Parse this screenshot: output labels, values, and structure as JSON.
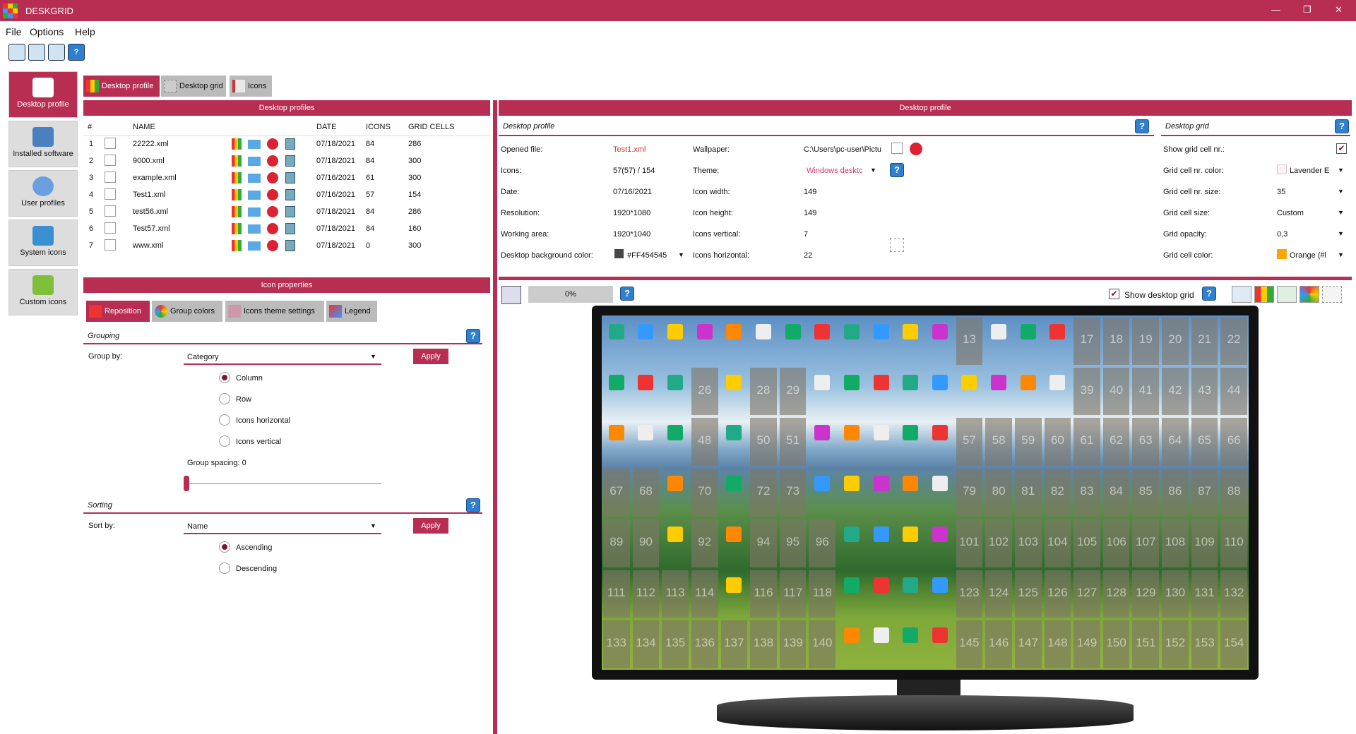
{
  "app": {
    "title": "DESKGRID"
  },
  "menu": [
    "File",
    "Options",
    "Help"
  ],
  "sidebar": [
    {
      "label": "Desktop profile",
      "active": true
    },
    {
      "label": "Installed software"
    },
    {
      "label": "User profiles"
    },
    {
      "label": "System icons"
    },
    {
      "label": "Custom icons"
    }
  ],
  "tabs": [
    {
      "label": "Desktop profile",
      "active": true
    },
    {
      "label": "Desktop grid"
    },
    {
      "label": "Icons"
    }
  ],
  "profiles": {
    "header": "Desktop profiles",
    "columns": [
      "#",
      "NAME",
      "DATE",
      "ICONS",
      "GRID CELLS"
    ],
    "rows": [
      {
        "n": "1",
        "name": "22222.xml",
        "date": "07/18/2021",
        "icons": "84",
        "cells": "286"
      },
      {
        "n": "2",
        "name": "9000.xml",
        "date": "07/18/2021",
        "icons": "84",
        "cells": "300"
      },
      {
        "n": "3",
        "name": "example.xml",
        "date": "07/16/2021",
        "icons": "61",
        "cells": "300"
      },
      {
        "n": "4",
        "name": "Test1.xml",
        "date": "07/16/2021",
        "icons": "57",
        "cells": "154"
      },
      {
        "n": "5",
        "name": "test56.xml",
        "date": "07/18/2021",
        "icons": "84",
        "cells": "286"
      },
      {
        "n": "6",
        "name": "Test57.xml",
        "date": "07/18/2021",
        "icons": "84",
        "cells": "160"
      },
      {
        "n": "7",
        "name": "www.xml",
        "date": "07/18/2021",
        "icons": "0",
        "cells": "300"
      }
    ]
  },
  "icon_props": {
    "header": "Icon properties",
    "tabs": [
      "Reposition",
      "Group colors",
      "Icons theme settings",
      "Legend"
    ],
    "grouping": {
      "title": "Grouping",
      "group_by_label": "Group by:",
      "group_by": "Category",
      "apply": "Apply",
      "options": [
        "Column",
        "Row",
        "Icons horizontal",
        "Icons vertical"
      ],
      "selected": "Column",
      "spacing_label": "Group spacing: 0"
    },
    "sorting": {
      "title": "Sorting",
      "sort_by_label": "Sort by:",
      "sort_by": "Name",
      "apply": "Apply",
      "options": [
        "Ascending",
        "Descending"
      ],
      "selected": "Ascending"
    }
  },
  "right": {
    "header": "Desktop profile",
    "profile_title": "Desktop profile",
    "grid_title": "Desktop grid",
    "fields": {
      "opened_file_label": "Opened file:",
      "opened_file": "Test1.xml",
      "icons_label": "Icons:",
      "icons": "57(57) / 154",
      "date_label": "Date:",
      "date": "07/16/2021",
      "resolution_label": "Resolution:",
      "resolution": "1920*1080",
      "working_label": "Working area:",
      "working": "1920*1040",
      "bg_label": "Desktop background color:",
      "bg": "#FF454545",
      "wallpaper_label": "Wallpaper:",
      "wallpaper": "C:\\Users\\pc-user\\Pictu",
      "theme_label": "Theme:",
      "theme": "Windows desktc",
      "icon_width_label": "Icon width:",
      "icon_width": "149",
      "icon_height_label": "Icon height:",
      "icon_height": "149",
      "icons_vertical_label": "Icons vertical:",
      "icons_vertical": "7",
      "icons_horizontal_label": "Icons horizontal:",
      "icons_horizontal": "22"
    },
    "grid": {
      "show_nr_label": "Show grid cell nr.:",
      "nr_color_label": "Grid cell nr. color:",
      "nr_color": "Lavender E",
      "nr_size_label": "Grid cell nr. size:",
      "nr_size": "35",
      "cell_size_label": "Grid cell size:",
      "cell_size": "Custom",
      "opacity_label": "Grid opacity:",
      "opacity": "0,3",
      "cell_color_label": "Grid cell color:",
      "cell_color": "Orange (#l"
    },
    "progress": "0%",
    "show_desktop_grid": "Show desktop grid"
  },
  "grid_cells": [
    "13",
    "17",
    "18",
    "19",
    "20",
    "21",
    "22",
    "26",
    "28",
    "29",
    "39",
    "40",
    "41",
    "42",
    "43",
    "44",
    "48",
    "50",
    "51",
    "57",
    "58",
    "59",
    "60",
    "61",
    "62",
    "63",
    "64",
    "65",
    "66",
    "67",
    "68",
    "70",
    "72",
    "73",
    "79",
    "80",
    "81",
    "82",
    "83",
    "84",
    "85",
    "86",
    "87",
    "88",
    "89",
    "90",
    "92",
    "94",
    "95",
    "96",
    "101",
    "102",
    "103",
    "104",
    "105",
    "106",
    "107",
    "108",
    "109",
    "110",
    "111",
    "112",
    "113",
    "114",
    "116",
    "117",
    "118",
    "123",
    "124",
    "125",
    "126",
    "127",
    "128",
    "129",
    "130",
    "131",
    "132",
    "133",
    "134",
    "135",
    "136",
    "137",
    "138",
    "139",
    "140",
    "145",
    "146",
    "147",
    "148",
    "149",
    "150",
    "151",
    "152",
    "153",
    "154"
  ],
  "colors": {
    "accent": "#b82e52"
  }
}
